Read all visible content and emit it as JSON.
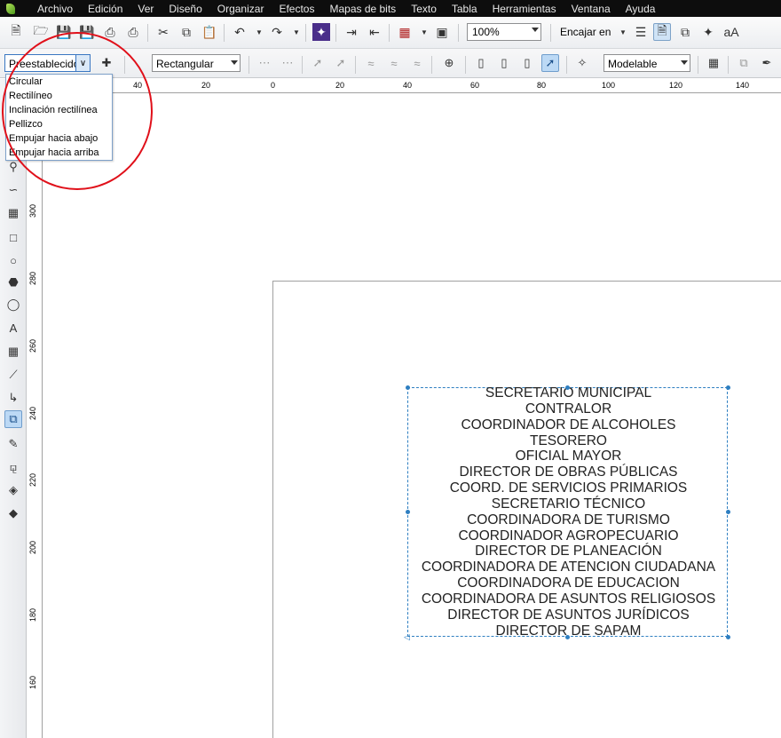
{
  "menu": [
    {
      "label": "Archivo"
    },
    {
      "label": "Edición"
    },
    {
      "label": "Ver"
    },
    {
      "label": "Diseño"
    },
    {
      "label": "Organizar"
    },
    {
      "label": "Efectos"
    },
    {
      "label": "Mapas de bits"
    },
    {
      "label": "Texto"
    },
    {
      "label": "Tabla"
    },
    {
      "label": "Herramientas"
    },
    {
      "label": "Ventana"
    },
    {
      "label": "Ayuda"
    }
  ],
  "standard_toolbar": {
    "zoom_value": "100%",
    "snap_label": "Encajar en"
  },
  "property_bar": {
    "presets_value": "Preestablecidos",
    "envelope_mode_value": "Rectangular",
    "mapping_mode_value": "Modelable"
  },
  "presets_dropdown": {
    "options": [
      "Circular",
      "Rectilíneo",
      "Inclinación rectilínea",
      "Pellizco",
      "Empujar hacia abajo",
      "Empujar hacia arriba"
    ]
  },
  "horizontal_ruler": {
    "labels": [
      "40",
      "20",
      "0",
      "20",
      "40",
      "60",
      "80",
      "100",
      "120",
      "140"
    ]
  },
  "vertical_ruler": {
    "labels": [
      "300",
      "280",
      "260",
      "240",
      "220",
      "200",
      "180",
      "160"
    ]
  },
  "document_text": {
    "lines": [
      "SECRETARIO MUNICIPAL",
      "CONTRALOR",
      "COORDINADOR DE ALCOHOLES",
      "TESORERO",
      "OFICIAL MAYOR",
      "DIRECTOR DE OBRAS PÚBLICAS",
      "COORD. DE SERVICIOS PRIMARIOS",
      "SECRETARIO TÉCNICO",
      "COORDINADORA DE TURISMO",
      "COORDINADOR AGROPECUARIO",
      "DIRECTOR DE PLANEACIÓN",
      "COORDINADORA DE ATENCION CIUDADANA",
      "COORDINADORA  DE EDUCACION",
      "COORDINADORA  DE ASUNTOS RELIGIOSOS",
      "DIRECTOR DE ASUNTOS JURÍDICOS",
      "DIRECTOR DE SAPAM"
    ]
  },
  "colors": {
    "menubar_bg": "#0d0d0d",
    "selection": "#2e7fc1",
    "annotation": "#e0101a"
  },
  "icons": {
    "toolbox": [
      "zoom-icon",
      "freehand-icon",
      "smart-fill-icon",
      "rectangle-icon",
      "ellipse-icon",
      "polygon-icon",
      "basic-shapes-icon",
      "text-icon",
      "table-icon",
      "dimension-icon",
      "connector-icon",
      "envelope-icon",
      "eyedropper-icon",
      "outline-pen-icon",
      "fill-icon",
      "interactive-fill-icon"
    ]
  }
}
